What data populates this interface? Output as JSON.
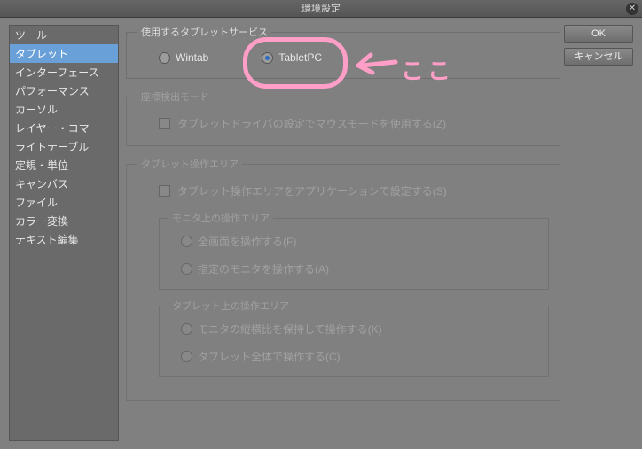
{
  "title": "環境設定",
  "buttons": {
    "ok": "OK",
    "cancel": "キャンセル"
  },
  "sidebar": {
    "items": [
      "ツール",
      "タブレット",
      "インターフェース",
      "パフォーマンス",
      "カーソル",
      "レイヤー・コマ",
      "ライトテーブル",
      "定規・単位",
      "キャンバス",
      "ファイル",
      "カラー変換",
      "テキスト編集"
    ],
    "selected": 1
  },
  "tabletService": {
    "legend": "使用するタブレットサービス",
    "options": {
      "wintab": "Wintab",
      "tabletpc": "TabletPC"
    },
    "value": "tabletpc"
  },
  "coordMode": {
    "legend": "座標検出モード",
    "checkbox": "タブレットドライバの設定でマウスモードを使用する(Z)",
    "checked": false
  },
  "tabletArea": {
    "legend": "タブレット操作エリア",
    "checkbox": "タブレット操作エリアをアプリケーションで設定する(S)",
    "checked": false,
    "monitorArea": {
      "legend": "モニタ上の操作エリア",
      "options": {
        "full": "全画面を操作する(F)",
        "specific": "指定のモニタを操作する(A)"
      }
    },
    "tabletSubArea": {
      "legend": "タブレット上の操作エリア",
      "options": {
        "aspect": "モニタの縦横比を保持して操作する(K)",
        "whole": "タブレット全体で操作する(C)"
      }
    }
  },
  "annotation": {
    "text": "ここ"
  }
}
